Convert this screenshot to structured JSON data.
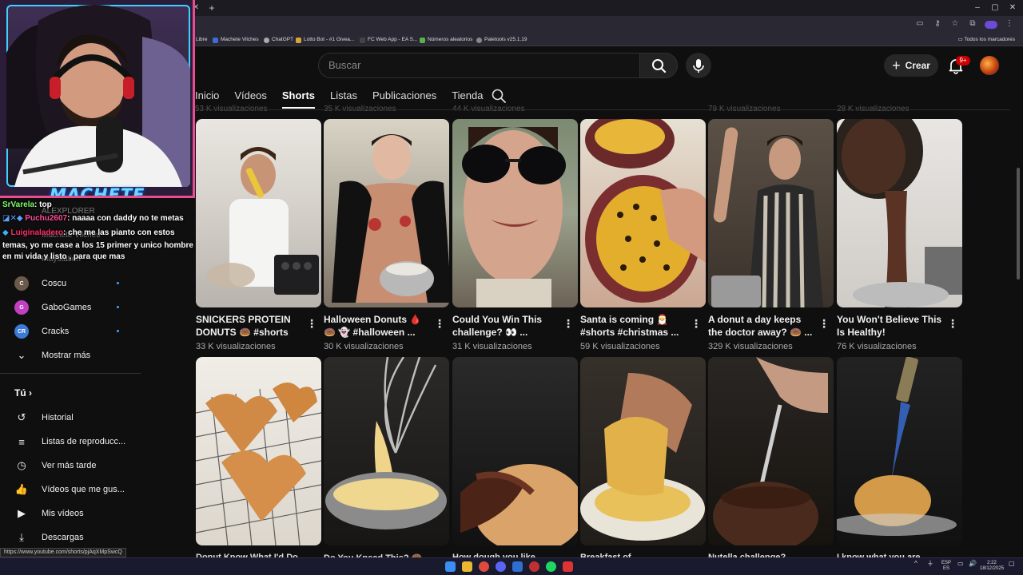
{
  "browser": {
    "bookmarks": [
      {
        "label": "Libre"
      },
      {
        "label": "Machete Vilches"
      },
      {
        "label": "ChatGPT"
      },
      {
        "label": "Lotto Bot - #1 Givea..."
      },
      {
        "label": "FC Web App - EA S..."
      },
      {
        "label": "Números aleatorios"
      },
      {
        "label": "Paletools v25.1.19"
      }
    ],
    "all_bookmarks": "Todos los marcadores",
    "status_url": "https://www.youtube.com/shorts/pjAqXMpSwcQ"
  },
  "header": {
    "search_placeholder": "Buscar",
    "create_label": "Crear",
    "notif_badge": "9+"
  },
  "channel_tabs": [
    {
      "label": "Inicio",
      "active": false
    },
    {
      "label": "Vídeos",
      "active": false
    },
    {
      "label": "Shorts",
      "active": true
    },
    {
      "label": "Listas",
      "active": false
    },
    {
      "label": "Publicaciones",
      "active": false
    },
    {
      "label": "Tienda",
      "active": false
    }
  ],
  "ghost_prev_row": [
    "53 K visualizaciones",
    "35 K visualizaciones",
    "44 K visualizaciones",
    "79 K visualizaciones",
    "28 K visualizaciones"
  ],
  "shorts_row1": [
    {
      "title": "SNICKERS PROTEIN DONUTS 🍩 #shorts",
      "views": "33 K visualizaciones"
    },
    {
      "title": "Halloween Donuts 🩸 🍩 👻 #halloween ...",
      "views": "30 K visualizaciones"
    },
    {
      "title": "Could You Win This challenge? 👀 ...",
      "views": "31 K visualizaciones"
    },
    {
      "title": "Santa is coming 🎅 #shorts #christmas ...",
      "views": "59 K visualizaciones"
    },
    {
      "title": "A donut a day keeps the doctor away? 🍩 ...",
      "views": "329 K visualizaciones"
    },
    {
      "title": "You Won't Believe This Is Healthy!",
      "views": "76 K visualizaciones"
    }
  ],
  "shorts_row2_titles": [
    "Donut Know What I'd Do...",
    "Do You Knead This? 🍩",
    "How dough you like...",
    "Breakfast of...",
    "Nutella challenge?",
    "I know what you are..."
  ],
  "sidebar": {
    "subs": [
      {
        "label": "Coscu",
        "initials": "C",
        "color": "#6b5a4a"
      },
      {
        "label": "GaboGames",
        "initials": "G",
        "color": "#c040c0"
      },
      {
        "label": "Cracks",
        "initials": "CR",
        "color": "#3a7bd5"
      }
    ],
    "show_more": "Mostrar más",
    "you_header": "Tú",
    "you_items": [
      {
        "label": "Historial",
        "icon": "history-icon"
      },
      {
        "label": "Listas de reproducc...",
        "icon": "playlist-icon"
      },
      {
        "label": "Ver más tarde",
        "icon": "clock-icon"
      },
      {
        "label": "Vídeos que me gus...",
        "icon": "thumbs-up-icon"
      },
      {
        "label": "Mis vídeos",
        "icon": "play-square-icon"
      },
      {
        "label": "Descargas",
        "icon": "download-icon"
      }
    ]
  },
  "chat": {
    "lines": [
      {
        "user": "SrVarela",
        "user_color": "#7dff6b",
        "text": ": top"
      },
      {
        "user": "Puchu2607",
        "user_color": "#ff4b9b",
        "text": ": naaaa con daddy no te metas"
      },
      {
        "user": "Luiginaladero",
        "user_color": "#ff2d6b",
        "text": ": che me las pianto con estos"
      },
      {
        "user": "",
        "user_color": "#ffffff",
        "text": "temas, yo me case a los 15 primer y unico hombre"
      },
      {
        "user": "",
        "user_color": "#ffffff",
        "text": "en mi vida y listo , para que mas"
      }
    ],
    "ghost_texts": [
      "ALEXPLORER",
      "Machete Vilches",
      "Playstation"
    ]
  },
  "webcam": {
    "overlay_text": "MACHETE"
  },
  "taskbar": {
    "lang": "ESP",
    "lang2": "ES",
    "time": "2:22",
    "date": "18/12/2025"
  },
  "colors": {
    "accent_red": "#cc0000",
    "link_blue": "#3ea6ff",
    "webcam_border": "#e94d8f"
  }
}
